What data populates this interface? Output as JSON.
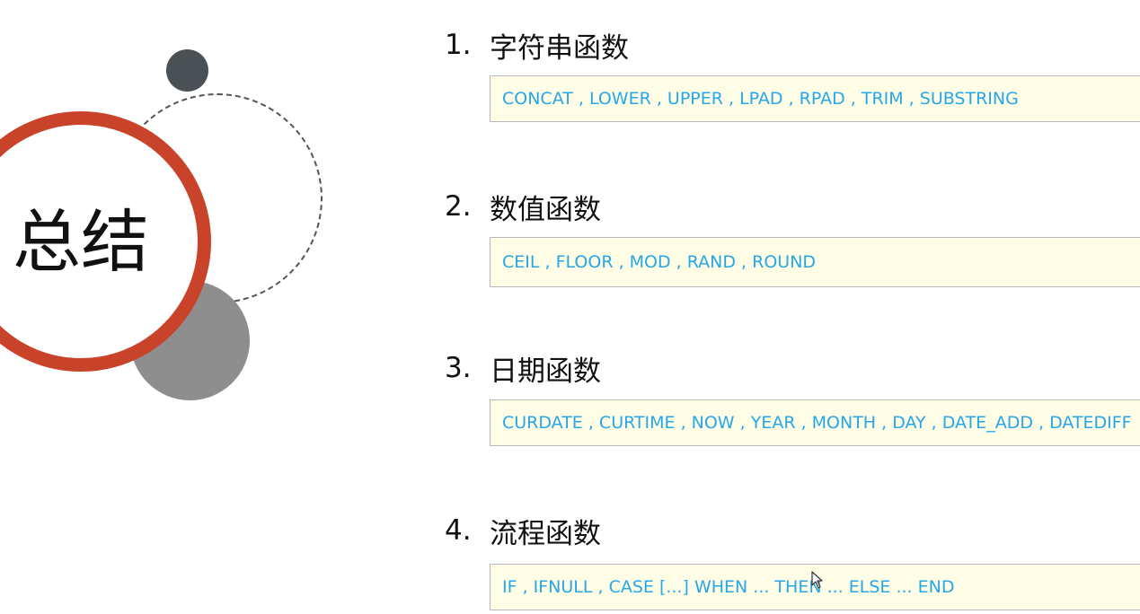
{
  "title": "总结",
  "sections": [
    {
      "number": "1.",
      "heading": "字符串函数",
      "functions": "CONCAT , LOWER , UPPER , LPAD , RPAD , TRIM , SUBSTRING"
    },
    {
      "number": "2.",
      "heading": "数值函数",
      "functions": "CEIL , FLOOR , MOD , RAND , ROUND"
    },
    {
      "number": "3.",
      "heading": "日期函数",
      "functions": "CURDATE , CURTIME , NOW , YEAR , MONTH , DAY , DATE_ADD , DATEDIFF"
    },
    {
      "number": "4.",
      "heading": "流程函数",
      "functions": "IF  , IFNULL , CASE [...]  WHEN ...  THEN  ... ELSE ... END"
    }
  ],
  "colors": {
    "ring": "#c9432a",
    "dark_dot": "#4b5055",
    "grey_circle": "#8e8e8e",
    "box_background": "#fffde6",
    "function_text": "#25a7e8"
  },
  "icons": {
    "cursor": "mouse-pointer-icon"
  }
}
